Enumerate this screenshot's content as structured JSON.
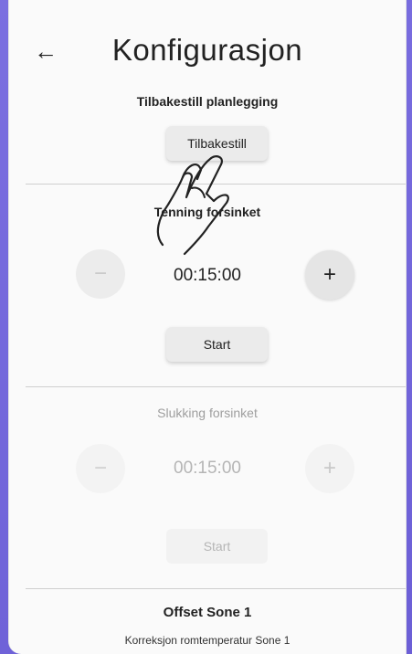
{
  "header": {
    "back_icon": "arrow-left-icon",
    "back_glyph": "←",
    "title": "Konfigurasjon"
  },
  "reset": {
    "title": "Tilbakestill planlegging",
    "button_label": "Tilbakestill"
  },
  "turn_on_delay": {
    "title": "Tenning forsinket",
    "time": "00:15:00",
    "minus": "−",
    "plus": "+",
    "start_label": "Start"
  },
  "turn_off_delay": {
    "title": "Slukking forsinket",
    "time": "00:15:00",
    "minus": "−",
    "plus": "+",
    "start_label": "Start"
  },
  "offset": {
    "title": "Offset Sone 1",
    "subtitle": "Korreksjon romtemperatur Sone 1"
  },
  "colors": {
    "accent": "#6c5fd6",
    "disabled_text": "#b5b5b5"
  }
}
